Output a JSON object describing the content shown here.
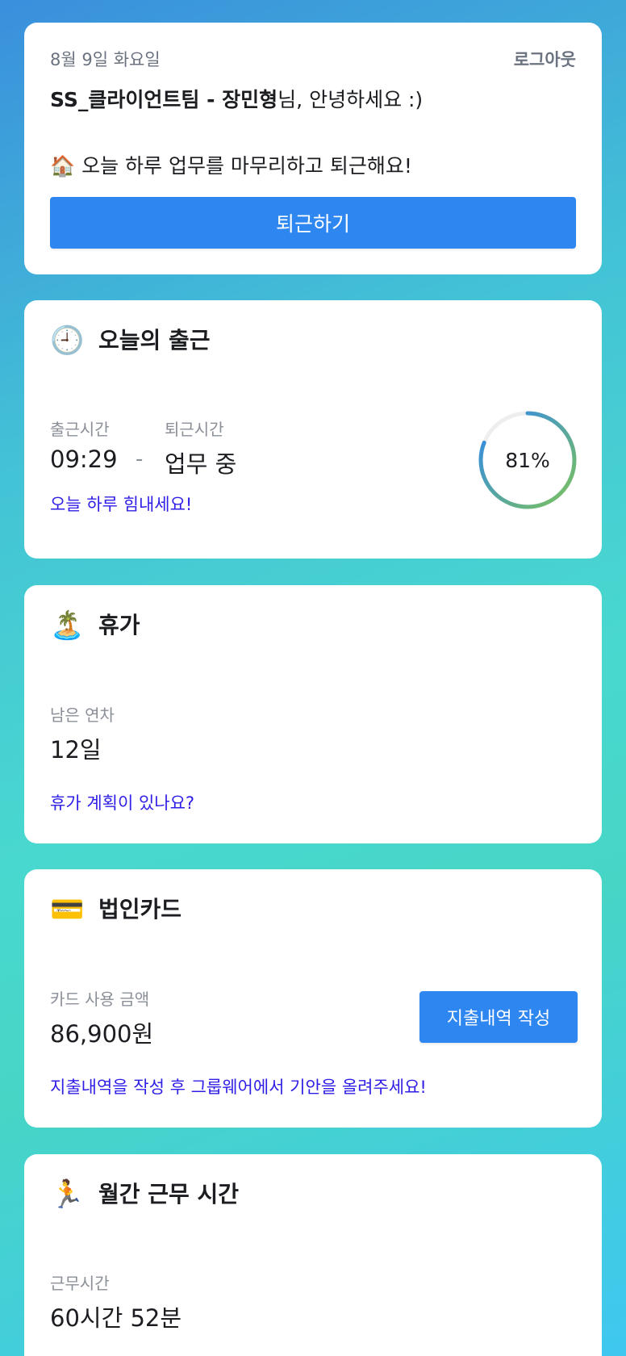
{
  "top": {
    "date": "8월 9일 화요일",
    "logout_label": "로그아웃",
    "greeting_name": "SS_클라이언트팀 - 장민형",
    "greeting_suffix": "님, 안녕하세요 :)",
    "message_icon": "🏠",
    "message": "오늘 하루 업무를 마무리하고 퇴근해요!",
    "leave_button_label": "퇴근하기"
  },
  "attendance": {
    "icon": "🕘",
    "icon_name": "clock-icon",
    "title": "오늘의 출근",
    "check_in_label": "출근시간",
    "check_in_value": "09:29",
    "separator": "-",
    "check_out_label": "퇴근시간",
    "check_out_value": "업무 중",
    "progress_text": "81%",
    "progress_fraction": 0.81,
    "hint": "오늘 하루 힘내세요!"
  },
  "vacation": {
    "icon": "🏝️",
    "icon_name": "beach-icon",
    "title": "휴가",
    "remaining_label": "남은 연차",
    "remaining_value": "12일",
    "hint": "휴가 계획이 있나요?"
  },
  "corp_card": {
    "icon": "💳",
    "icon_name": "credit-card-icon",
    "title": "법인카드",
    "usage_label": "카드 사용 금액",
    "usage_value": "86,900원",
    "expense_button_label": "지출내역 작성",
    "hint": "지출내역을 작성 후 그룹웨어에서 기안을 올려주세요!"
  },
  "monthly": {
    "icon": "🏃",
    "icon_name": "running-icon",
    "title": "월간 근무 시간",
    "work_label": "근무시간",
    "work_value": "60시간 52분"
  },
  "colors": {
    "primary": "#2e86f0",
    "hint": "#2f1ee6",
    "gauge_start": "#7cc35a",
    "gauge_end": "#2e86f0",
    "gauge_track": "#eeeeee"
  }
}
